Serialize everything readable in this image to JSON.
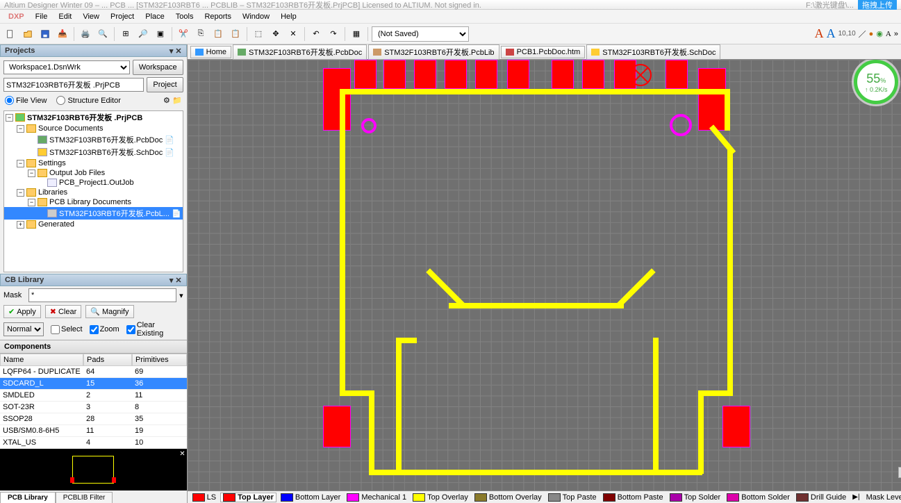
{
  "title": {
    "left_fragment": "Altium Designer Winter 09 – ... PCB ... [STM32F103RBT6 ... PCBLIB – STM32F103RBT6开发板.PrjPCB] Licensed to ALTIUM. Not signed in.",
    "right_path": "F:\\激光键盘\\...",
    "cloud_label": "拖拽上传"
  },
  "menu": {
    "dxp": "DXP",
    "items": [
      "File",
      "Edit",
      "View",
      "Project",
      "Place",
      "Tools",
      "Reports",
      "Window",
      "Help"
    ]
  },
  "toolbar": {
    "not_saved": "(Not Saved)"
  },
  "font_toolbar": {
    "sample": "10,10"
  },
  "projects_panel": {
    "title": "Projects",
    "workspace_value": "Workspace1.DsnWrk",
    "workspace_btn": "Workspace",
    "project_value": "STM32F103RBT6开发板 .PrjPCB",
    "project_btn": "Project",
    "file_view": "File View",
    "structure_editor": "Structure Editor",
    "tree": {
      "root": "STM32F103RBT6开发板 .PrjPCB",
      "source_docs": "Source Documents",
      "pcbdoc": "STM32F103RBT6开发板.PcbDoc",
      "schdoc": "STM32F103RBT6开发板.SchDoc",
      "settings": "Settings",
      "output_job": "Output Job Files",
      "outjob": "PCB_Project1.OutJob",
      "libraries": "Libraries",
      "pcb_lib_docs": "PCB Library Documents",
      "pcblib": "STM32F103RBT6开发板.PcbL...",
      "generated": "Generated"
    }
  },
  "library_panel": {
    "title": "CB Library",
    "mask_label": "Mask",
    "mask_value": "*",
    "apply": "Apply",
    "clear": "Clear",
    "magnify": "Magnify",
    "normal": "Normal",
    "select": "Select",
    "zoom": "Zoom",
    "clear_existing": "Clear Existing",
    "components_label": "Components",
    "headers": {
      "name": "Name",
      "pads": "Pads",
      "primitives": "Primitives"
    },
    "rows": [
      {
        "name": "LQFP64 - DUPLICATE",
        "pads": "64",
        "prim": "69"
      },
      {
        "name": "SDCARD_L",
        "pads": "15",
        "prim": "36"
      },
      {
        "name": "SMDLED",
        "pads": "2",
        "prim": "11"
      },
      {
        "name": "SOT-23R",
        "pads": "3",
        "prim": "8"
      },
      {
        "name": "SSOP28",
        "pads": "28",
        "prim": "35"
      },
      {
        "name": "USB/SM0.8-6H5",
        "pads": "11",
        "prim": "19"
      },
      {
        "name": "XTAL_US",
        "pads": "4",
        "prim": "10"
      }
    ],
    "bottom_tabs": {
      "pcb_library": "PCB Library",
      "pcblib_filter": "PCBLIB Filter"
    }
  },
  "doc_tabs": {
    "home": "Home",
    "pcbdoc": "STM32F103RBT6开发板.PcbDoc",
    "pcblib": "STM32F103RBT6开发板.PcbLib",
    "pcbhtm": "PCB1.PcbDoc.htm",
    "schdoc": "STM32F103RBT6开发板.SchDoc"
  },
  "layers": {
    "ls": "LS",
    "items": [
      {
        "label": "Top Layer",
        "color": "#f00"
      },
      {
        "label": "Bottom Layer",
        "color": "#00f"
      },
      {
        "label": "Mechanical 1",
        "color": "#f0f"
      },
      {
        "label": "Top Overlay",
        "color": "#ff0"
      },
      {
        "label": "Bottom Overlay",
        "color": "#8a7a2a"
      },
      {
        "label": "Top Paste",
        "color": "#888"
      },
      {
        "label": "Bottom Paste",
        "color": "#800000"
      },
      {
        "label": "Top Solder",
        "color": "#a0a"
      },
      {
        "label": "Bottom Solder",
        "color": "#d0a"
      },
      {
        "label": "Drill Guide",
        "color": "#703030"
      },
      {
        "label": "Mask Level",
        "color": "#888"
      }
    ]
  },
  "speed": {
    "big": "55",
    "pct": "%",
    "rate": "↑ 0.2K/s"
  }
}
